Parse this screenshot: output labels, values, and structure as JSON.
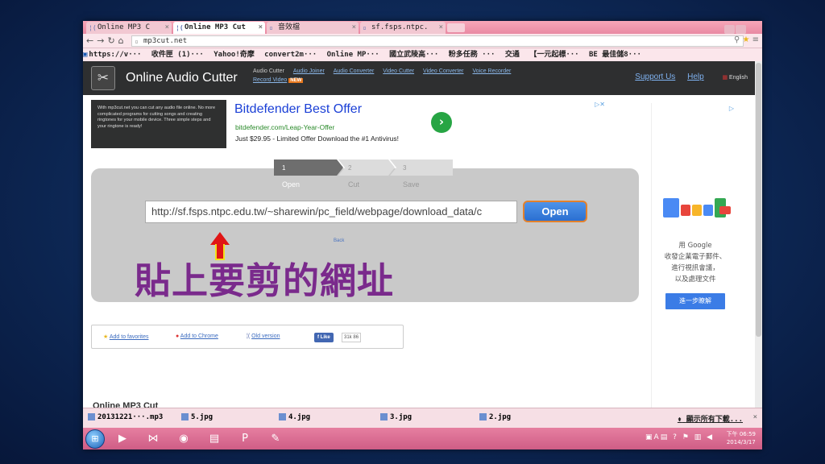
{
  "browser": {
    "tabs": [
      {
        "label": "Online MP3 C",
        "active": false
      },
      {
        "label": "Online MP3 Cut",
        "active": true
      },
      {
        "label": "音效檔",
        "active": false
      },
      {
        "label": "sf.fsps.ntpc.",
        "active": false
      }
    ],
    "url": "mp3cut.net",
    "bookmarks": [
      "https://v···",
      "收件匣 (1)···",
      "Yahoo!奇摩",
      "convert2m···",
      "Online MP···",
      "國立武陵高···",
      "粉多任務 ···",
      "交通",
      "【一元起標···",
      "BE 最佳儲8···"
    ]
  },
  "site": {
    "title": "Online Audio Cutter",
    "tools": [
      "Audio Cutter",
      "Audio Joiner",
      "Audio Converter",
      "Video Cutter",
      "Video Converter",
      "Voice Recorder"
    ],
    "record_video": "Record Video",
    "new_badge": "NEW",
    "support": "Support Us",
    "help": "Help",
    "language": "English"
  },
  "intro": "With mp3cut.net you can cut any audio file online. No more complicated programs for cutting songs and creating ringtones for your mobile device. Three simple steps and your ringtone is ready!",
  "ad": {
    "title": "Bitdefender Best Offer",
    "url": "bitdefender.com/Leap-Year-Offer",
    "desc": "Just $29.95 - Limited Offer Download the #1 Antivirus!"
  },
  "sidead": {
    "line1": "用 Google",
    "line2": "收發企業電子郵件、",
    "line3": "進行視訊會議，",
    "line4": "以及處理文件",
    "button": "進一步瞭解"
  },
  "steps": [
    {
      "num": "1",
      "label": "Open"
    },
    {
      "num": "2",
      "label": "Cut"
    },
    {
      "num": "3",
      "label": "Save"
    }
  ],
  "main": {
    "input_value": "http://sf.fsps.ntpc.edu.tw/~sharewin/pc_field/webpage/download_data/c",
    "open_button": "Open",
    "back": "Back",
    "annotation": "貼上要剪的網址"
  },
  "links": {
    "favorites": "Add to favorites",
    "chrome": "Add to Chrome",
    "old": "Old version",
    "like": "Like",
    "likes_count": "31k",
    "count2": "86"
  },
  "bottom_heading": "Online MP3 Cut",
  "downloads": {
    "items": [
      "20131221···.mp3",
      "5.jpg",
      "4.jpg",
      "3.jpg",
      "2.jpg"
    ],
    "show_all": "顯示所有下載...",
    "close": "×"
  },
  "taskbar": {
    "time": "下午 06:59",
    "date": "2014/3/17"
  }
}
